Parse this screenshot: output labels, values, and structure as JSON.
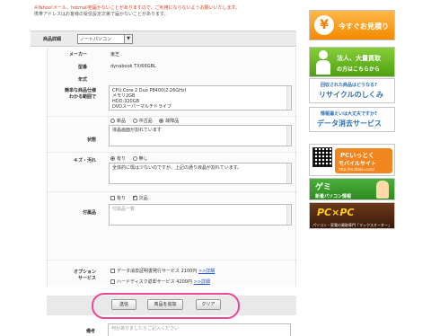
{
  "notice": {
    "line1": "※Yahoo!メール、hotmail宛届かないことがありますので、ご利用にならないようお願いいたします。",
    "line2": "携帯アドレスはお客様の受信設定次第で届かないことがあります。"
  },
  "header": {
    "label": "商品詳細",
    "select_value": "ノートパソコン"
  },
  "fields": {
    "maker_label": "メーカー",
    "maker_value": "東芝",
    "model_label": "型番",
    "model_value": "dynabook TX/66GBL",
    "year_label": "年式",
    "year_value": "",
    "spec_label_1": "簡単な商品仕様",
    "spec_label_2": "わかる範囲で",
    "spec_lines": [
      "CPU:Core 2 Duo P8400(2.26GHz)",
      "メモリ2GB",
      "HDD:320GB",
      "DVDスーパーマルチドライブ"
    ],
    "condition_label": "状態",
    "condition_options": [
      "新品",
      "中古品",
      "故障品"
    ],
    "condition_selected": 2,
    "condition_text": "液晶画面が割れています",
    "scratch_label": "キズ・汚れ",
    "scratch_options": [
      "有り",
      "無し"
    ],
    "scratch_selected": 0,
    "scratch_text": "全体的に傷は少ないのですが、上記の通り液晶が割れています。",
    "acc_label": "付属品",
    "acc_options": [
      "有り",
      "欠品"
    ],
    "acc_selected": 1,
    "acc_placeholder": "付属品一覧",
    "option_label_1": "オプション",
    "option_label_2": "サービス",
    "option1_text": "データ消去証明書発行サービス 2100円",
    "option2_text": "ハードディスク返却サービス 4200円",
    "detail_link": ">>詳細",
    "remarks_label": "備考",
    "remarks_placeholder": "何かありましたらご記入ください"
  },
  "buttons": {
    "submit": "送信",
    "add_item": "商品を追加",
    "clear": "クリア"
  },
  "sidebar": {
    "estimate": "今すぐお見積り",
    "corporate_1": "法人、大量買取",
    "corporate_2": "の方はこちらから",
    "recycle_sub": "回収された商品はどうなる?",
    "recycle": "リサイクルのしくみ",
    "erase_sub": "情報漏えいは大丈夫ですか?",
    "erase": "データ消去サービス",
    "mobile_1": "PCいっとく",
    "mobile_2": "モバイルサイト",
    "mobile_url": "http://m.ittoku.com/",
    "gemi_sub": "新着パソコン情報",
    "pc_shop": "パソコン・家電の買取専門「マックスオーター」"
  },
  "colors": {
    "orange": "#f28a00",
    "green": "#4f9f10",
    "pink_ring": "#e8479a",
    "link": "#2255cc"
  }
}
